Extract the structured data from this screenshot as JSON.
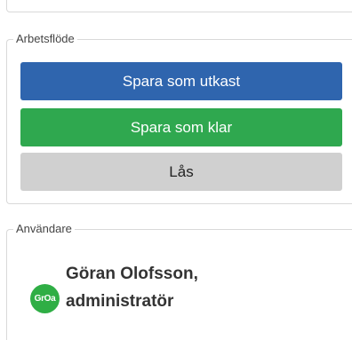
{
  "workflow": {
    "legend": "Arbetsflöde",
    "save_draft_label": "Spara som utkast",
    "save_ready_label": "Spara som klar",
    "lock_label": "Lås"
  },
  "users": {
    "legend": "Användare",
    "user": {
      "initials": "GrOa",
      "name_line1": "Göran Olofsson,",
      "name_line2": "administratör",
      "avatar_color": "#2fae45"
    }
  },
  "colors": {
    "draft_button": "#2f65ae",
    "ready_button": "#2fa84f",
    "lock_button": "#d0d0d0"
  }
}
